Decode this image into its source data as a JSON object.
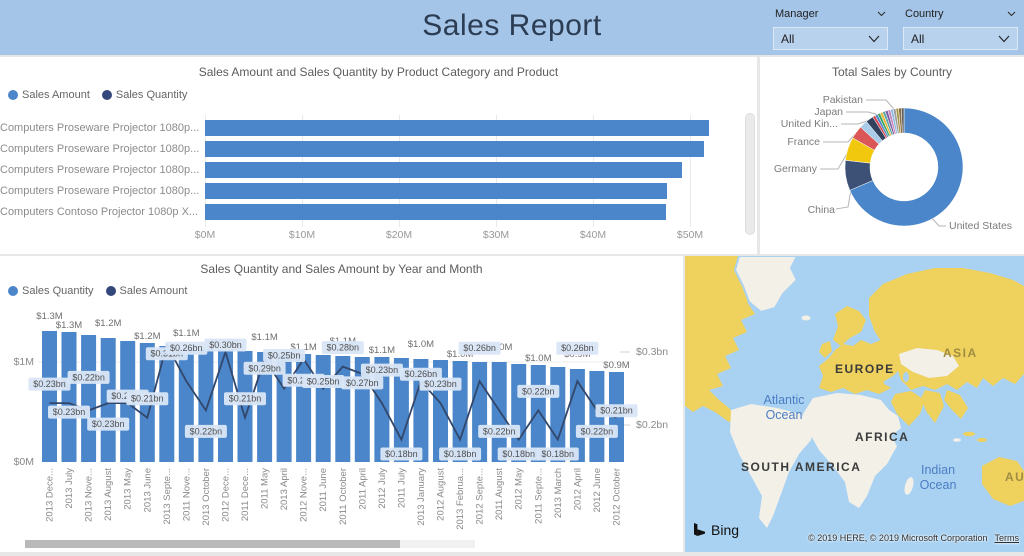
{
  "header": {
    "title": "Sales Report",
    "background": "#A4C5E8",
    "slicers": [
      {
        "label": "Manager",
        "value": "All"
      },
      {
        "label": "Country",
        "value": "All"
      }
    ]
  },
  "colors": {
    "primary_blue": "#4A86C9",
    "dark_navy": "#33477B",
    "callout_bg": "#D9E6F7",
    "header_blue": "#A4C5E8",
    "map_ocean": "#A9D2F2",
    "map_land": "#F3F0E8",
    "map_highlight": "#EFD15E"
  },
  "chart_data": [
    {
      "id": "product_bars",
      "type": "bar",
      "title": "Sales Amount and Sales Quantity by Product Category and Product",
      "legend": [
        {
          "label": "Sales Amount",
          "color": "#4A86C9"
        },
        {
          "label": "Sales Quantity",
          "color": "#33477B"
        }
      ],
      "categories": [
        "Computers Proseware Projector 1080p...",
        "Computers Proseware Projector 1080p...",
        "Computers Proseware Projector 1080p...",
        "Computers Proseware Projector 1080p...",
        "Computers Contoso Projector 1080p X..."
      ],
      "values": [
        52.0,
        51.4,
        49.2,
        47.6,
        47.5
      ],
      "unit": "$M",
      "x_ticks": [
        "$0M",
        "$10M",
        "$20M",
        "$30M",
        "$40M",
        "$50M"
      ],
      "xlim": [
        0,
        55
      ],
      "legend_position": "top-left"
    },
    {
      "id": "country_donut",
      "type": "pie",
      "title": "Total Sales by Country",
      "slices": [
        {
          "label": "United States",
          "value": 68.5,
          "color": "#4A86C9"
        },
        {
          "label": "China",
          "value": 8.3,
          "color": "#3D5177"
        },
        {
          "label": "Germany",
          "value": 6.4,
          "color": "#F2C80F"
        },
        {
          "label": "France",
          "value": 3.6,
          "color": "#DB5757"
        },
        {
          "label": "United Kin...",
          "value": 2.2,
          "color": "#A9CCE9"
        },
        {
          "label": "Japan",
          "value": 2.1,
          "color": "#32425E"
        },
        {
          "label": "",
          "value": 0.74,
          "color": "#D64550"
        },
        {
          "label": "",
          "value": 0.74,
          "color": "#4A86C9"
        },
        {
          "label": "",
          "value": 0.74,
          "color": "#3BA55C"
        },
        {
          "label": "",
          "value": 0.74,
          "color": "#E8B63C"
        },
        {
          "label": "",
          "value": 0.74,
          "color": "#5BA8A0"
        },
        {
          "label": "",
          "value": 0.74,
          "color": "#7D5BA6"
        },
        {
          "label": "",
          "value": 0.74,
          "color": "#C987B9"
        },
        {
          "label": "",
          "value": 0.74,
          "color": "#8FBCE6"
        },
        {
          "label": "Pakistan",
          "value": 0.74,
          "color": "#9E9E9E"
        },
        {
          "label": "",
          "value": 0.74,
          "color": "#A89A4A"
        },
        {
          "label": "",
          "value": 0.74,
          "color": "#8B6C42"
        },
        {
          "label": "",
          "value": 0.74,
          "color": "#606060"
        }
      ]
    },
    {
      "id": "month_combo",
      "type": "bar+line",
      "title": "Sales Quantity and Sales Amount by Year and Month",
      "legend": [
        {
          "label": "Sales Quantity",
          "color": "#4A86C9"
        },
        {
          "label": "Sales Amount",
          "color": "#33477B"
        }
      ],
      "categories": [
        "2013 Dece...",
        "2013 July",
        "2013 Nove...",
        "2013 August",
        "2013 May",
        "2013 June",
        "2013 Septe...",
        "2011 Nove...",
        "2013 October",
        "2012 Dece...",
        "2011 Dece...",
        "2011 May",
        "2013 April",
        "2012 Nove...",
        "2011 June",
        "2011 October",
        "2011 April",
        "2012 July",
        "2011 July",
        "2013 January",
        "2012 August",
        "2013 Februa...",
        "2012 Septe...",
        "2011 August",
        "2012 May",
        "2011 Septe...",
        "2013 March",
        "2012 April",
        "2012 June",
        "2012 October"
      ],
      "left_axis_ticks": [
        "$1M",
        "$0M"
      ],
      "right_axis_ticks": [
        "$0.3bn",
        "$0.2bn"
      ],
      "series": [
        {
          "name": "Sales Quantity",
          "type": "column",
          "unit": "M",
          "values": [
            1.31,
            1.3,
            1.27,
            1.24,
            1.21,
            1.19,
            1.16,
            1.14,
            1.13,
            1.12,
            1.11,
            1.1,
            1.09,
            1.08,
            1.07,
            1.06,
            1.05,
            1.05,
            1.04,
            1.03,
            1.02,
            1.01,
            1.0,
            1.0,
            0.98,
            0.97,
            0.95,
            0.93,
            0.91,
            0.9
          ],
          "labels": [
            "$1.3M",
            "$1.3M",
            null,
            "$1.2M",
            null,
            "$1.2M",
            null,
            "$1.1M",
            null,
            "$1.1M",
            null,
            "$1.1M",
            null,
            "$1.1M",
            null,
            "$1.1M",
            null,
            "$1.1M",
            null,
            "$1.0M",
            null,
            "$1.0M",
            null,
            "$1.0M",
            null,
            "$1.0M",
            null,
            "$0.9M",
            null,
            "$0.9M"
          ]
        },
        {
          "name": "Sales Amount",
          "type": "line",
          "unit": "bn",
          "values": [
            0.23,
            0.23,
            0.22,
            0.23,
            0.23,
            0.21,
            0.31,
            0.26,
            0.22,
            0.3,
            0.21,
            0.29,
            0.25,
            0.29,
            0.25,
            0.28,
            0.27,
            0.23,
            0.18,
            0.26,
            0.23,
            0.18,
            0.26,
            0.22,
            0.18,
            0.22,
            0.18,
            0.26,
            0.22,
            0.21
          ],
          "labels": [
            "$0.23bn",
            "$0.23bn",
            "$0.22bn",
            "$0.23bn",
            "$0.23bn",
            "$0.21bn",
            "$0.31bn",
            "$0.26bn",
            "$0.22bn",
            "$0.30bn",
            "$0.21bn",
            "$0.29bn",
            "$0.25bn",
            "$0.29bn",
            "$0.25bn",
            "$0.28bn",
            "$0.27bn",
            "$0.23bn",
            "$0.18bn",
            "$0.26bn",
            "$0.23bn",
            "$0.18bn",
            "$0.26bn",
            "$0.22bn",
            "$0.18bn",
            "$0.22bn",
            "$0.18bn",
            "$0.26bn",
            "$0.22bn",
            "$0.21bn"
          ]
        }
      ]
    }
  ],
  "map": {
    "continent_labels": [
      "EUROPE",
      "ASIA",
      "AFRICA",
      "SOUTH AMERICA",
      "AUS"
    ],
    "ocean_labels": [
      {
        "line1": "Atlantic",
        "line2": "Ocean"
      },
      {
        "line1": "Indian",
        "line2": "Ocean"
      }
    ],
    "bing_label": "Bing",
    "attribution": "© 2019 HERE, © 2019 Microsoft Corporation",
    "terms_label": "Terms"
  }
}
